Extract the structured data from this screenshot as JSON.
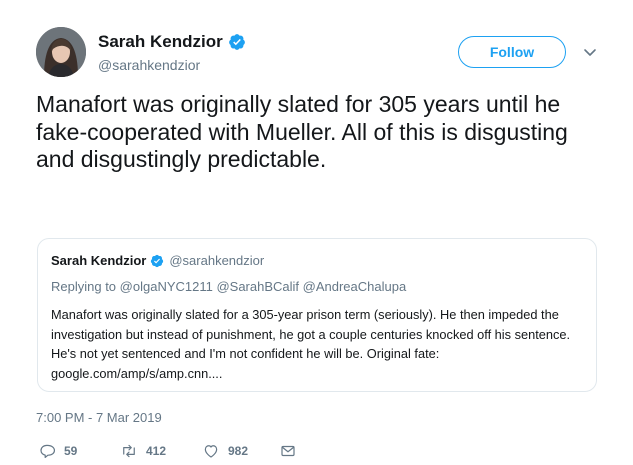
{
  "author": {
    "name": "Sarah Kendzior",
    "handle": "@sarahkendzior"
  },
  "follow_label": "Follow",
  "tweet": {
    "text": "Manafort was originally slated for 305 years until he fake-cooperated with Mueller. All of this is disgusting and disgustingly predictable.",
    "timestamp": "7:00 PM - 7 Mar 2019"
  },
  "quoted": {
    "name": "Sarah Kendzior",
    "handle": "@sarahkendzior",
    "replying_prefix": "Replying to",
    "replying_to": "@olgaNYC1211 @SarahBCalif @AndreaChalupa",
    "text": "Manafort was originally slated for a 305-year prison term (seriously). He then impeded the investigation but instead of punishment, he got a couple centuries knocked off his sentence. He's not yet sentenced and I'm not confident he will be. Original fate: google.com/amp/s/amp.cnn...."
  },
  "actions": {
    "replies": "59",
    "retweets": "412",
    "likes": "982"
  },
  "colors": {
    "accent": "#1da1f2",
    "muted": "#657786",
    "text": "#14171a",
    "border": "#e1e8ed"
  },
  "icons": [
    "verified-badge-icon",
    "chevron-down-icon",
    "reply-icon",
    "retweet-icon",
    "like-icon",
    "direct-message-icon"
  ]
}
